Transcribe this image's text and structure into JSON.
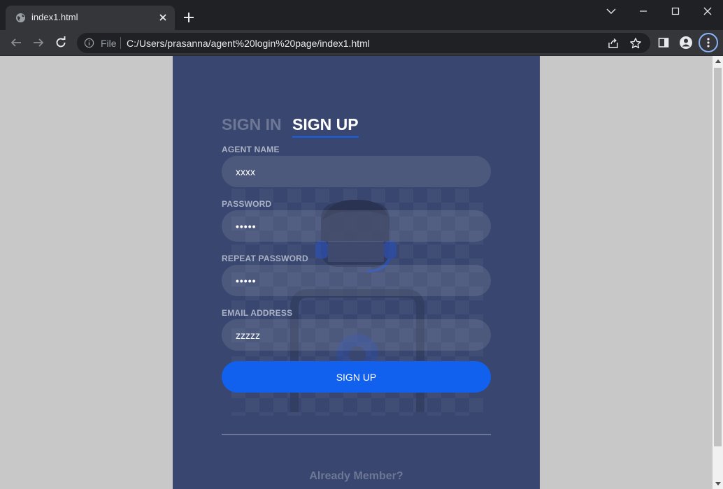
{
  "browser": {
    "tab_title": "index1.html",
    "omnibox_scheme": "File",
    "url": "C:/Users/prasanna/agent%20login%20page/index1.html"
  },
  "form": {
    "tab_signin_label": "SIGN IN",
    "tab_signup_label": "SIGN UP",
    "active_tab": "SIGN UP",
    "agent_name_label": "AGENT NAME",
    "agent_name_value": "xxxx",
    "password_label": "PASSWORD",
    "password_value": "•••••",
    "repeat_password_label": "REPEAT PASSWORD",
    "repeat_password_value": "•••••",
    "email_label": "EMAIL ADDRESS",
    "email_value": "zzzzz",
    "submit_label": "SIGN UP",
    "footer_link": "Already Member?"
  },
  "colors": {
    "page_bg": "#c8c8c8",
    "card_bg": "#39466f",
    "accent": "#1161ee",
    "chrome_dark": "#202124",
    "chrome_toolbar": "#35363a"
  }
}
